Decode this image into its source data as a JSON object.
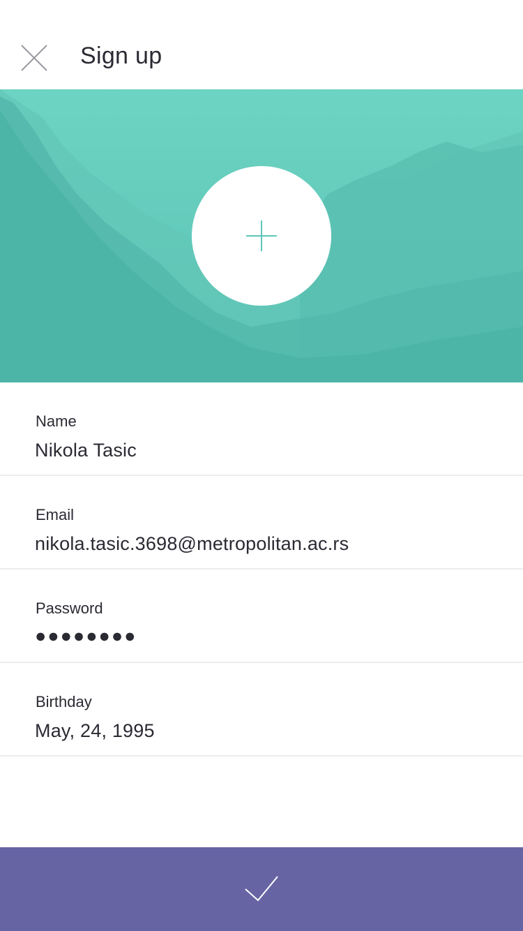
{
  "header": {
    "title": "Sign up",
    "close_icon": "close-icon"
  },
  "hero": {
    "background_color": "#5ec6b8",
    "add_photo_icon": "plus-icon"
  },
  "form": {
    "fields": [
      {
        "label": "Name",
        "value": "Nikola Tasic"
      },
      {
        "label": "Email",
        "value": "nikola.tasic.3698@metropolitan.ac.rs"
      },
      {
        "label": "Password",
        "value": "●●●●●●●●"
      },
      {
        "label": "Birthday",
        "value": "May, 24, 1995"
      }
    ]
  },
  "submit": {
    "icon": "checkmark-icon",
    "color": "#6764a4"
  }
}
